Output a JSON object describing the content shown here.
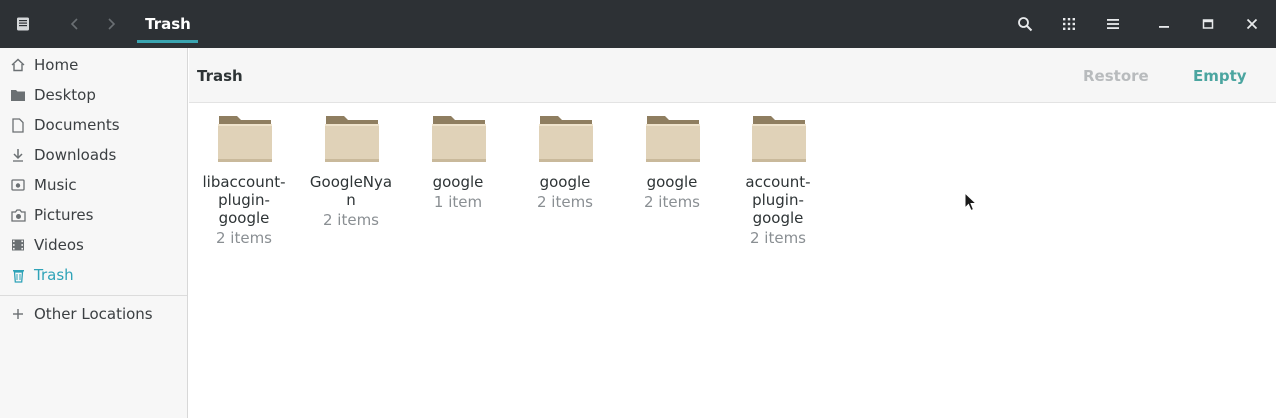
{
  "window": {
    "title": "Trash"
  },
  "sidebar": {
    "items": [
      {
        "label": "Home",
        "icon": "home-icon"
      },
      {
        "label": "Desktop",
        "icon": "folder-icon"
      },
      {
        "label": "Documents",
        "icon": "document-icon"
      },
      {
        "label": "Downloads",
        "icon": "download-icon"
      },
      {
        "label": "Music",
        "icon": "music-icon"
      },
      {
        "label": "Pictures",
        "icon": "camera-icon"
      },
      {
        "label": "Videos",
        "icon": "video-icon"
      },
      {
        "label": "Trash",
        "icon": "trash-icon",
        "active": true
      }
    ],
    "other_locations": "Other Locations"
  },
  "actionbar": {
    "title": "Trash",
    "restore_label": "Restore",
    "empty_label": "Empty"
  },
  "files": [
    {
      "name_lines": [
        "libaccount-",
        "plugin-",
        "google"
      ],
      "count": "2 items"
    },
    {
      "name_lines": [
        "GoogleNya",
        "n"
      ],
      "count": "2 items"
    },
    {
      "name_lines": [
        "google"
      ],
      "count": "1 item"
    },
    {
      "name_lines": [
        "google"
      ],
      "count": "2 items"
    },
    {
      "name_lines": [
        "google"
      ],
      "count": "2 items"
    },
    {
      "name_lines": [
        "account-",
        "plugin-",
        "google"
      ],
      "count": "2 items"
    }
  ],
  "colors": {
    "headerbar": "#2d3135",
    "accent": "#2fa3b8",
    "empty_button": "#4ba5a0",
    "folder_body": "#e0d2b8",
    "folder_tab": "#8f7e60"
  }
}
